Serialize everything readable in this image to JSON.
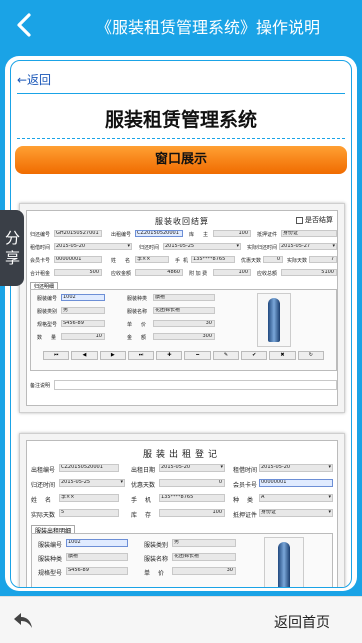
{
  "header": {
    "title": "《服装租赁管理系统》操作说明"
  },
  "content": {
    "return_link": "←返回",
    "main_title": "服装租赁管理系统",
    "window_button": "窗口展示"
  },
  "share_tab": {
    "label": "分享"
  },
  "shot1": {
    "title": "服装收回结算",
    "checkbox": "是否结算",
    "r1": {
      "l1": "归还编号",
      "v1": "GH20150527001",
      "l2": "出租编号",
      "v2": "CZ20150520001",
      "l3": "库",
      "l3b": "主",
      "v3": "100",
      "l4": "抵押证件",
      "v4": "身份证"
    },
    "r2": {
      "l1": "租借时间",
      "v1": "2015-05-20",
      "l2": "归还时间",
      "v2": "2015-05-25",
      "l3": "实际归还时间",
      "v3": "2015-05-27"
    },
    "r3": {
      "l1": "会员卡号",
      "v1": "00000001",
      "l2": "姓",
      "l2b": "名",
      "v2": "李××",
      "l3": "手",
      "l3b": "机",
      "v3": "135****8765",
      "l4": "优惠天数",
      "v4": "0",
      "l5": "实际天数",
      "v5": "7"
    },
    "r4": {
      "l1": "合计租金",
      "v1": "500",
      "l2": "应收金额",
      "v2": "4860",
      "l3": "附 加 费",
      "v3": "100",
      "l4": "应收总额",
      "v4": "5100"
    },
    "tab": "归还明细",
    "p1": {
      "l1": "服装编号",
      "v1": "1002",
      "l2": "服装种类",
      "v2": "旗袍"
    },
    "p2": {
      "l1": "服装类别",
      "v1": "男",
      "l2": "服装名称",
      "v2": "花团锦长袍"
    },
    "p3": {
      "l1": "规格型号",
      "v1": "S456-89",
      "l2": "单",
      "l2b": "价",
      "v2": "30"
    },
    "p4": {
      "l1": "数",
      "l1b": "量",
      "v1": "10",
      "l2": "金",
      "l2b": "额",
      "v2": "300"
    },
    "nav": [
      "⏮",
      "◀",
      "▶",
      "⏭",
      "✚",
      "━",
      "✎",
      "✔",
      "✖",
      "↻"
    ],
    "remarks": "备注说明"
  },
  "shot2": {
    "title": "服装出租登记",
    "r1": {
      "l1": "出租编号",
      "v1": "CZ20150520001",
      "l2": "出租日期",
      "v2": "2015-05-20",
      "l3": "租借时间",
      "v3": "2015-05-20"
    },
    "r2": {
      "l1": "归还时间",
      "v1": "2015-05-25",
      "l2": "优惠天数",
      "v2": "0",
      "l3": "会员卡号",
      "v3": "00000001"
    },
    "r3": {
      "l1": "姓",
      "l1b": "名",
      "v1": "李××",
      "l2": "手",
      "l2b": "机",
      "v2": "135****8765",
      "l3": "种",
      "l3b": "类",
      "v3": "A"
    },
    "r4": {
      "l1": "实际天数",
      "v1": "5",
      "l2": "库",
      "l2b": "存",
      "v2": "100",
      "l3": "抵押证件",
      "v3": "身份证"
    },
    "tab": "服装出租明细",
    "p1": {
      "l1": "服装编号",
      "v1": "1002",
      "l2": "服装类别",
      "v2": "男"
    },
    "p2": {
      "l1": "服装种类",
      "v1": "旗袍",
      "l2": "服装名称",
      "v2": "花团锦长袍"
    },
    "p3": {
      "l1": "规格型号",
      "v1": "S456-89",
      "l2": "单",
      "l2b": "价",
      "v2": "30"
    }
  },
  "footer": {
    "home": "返回首页"
  }
}
